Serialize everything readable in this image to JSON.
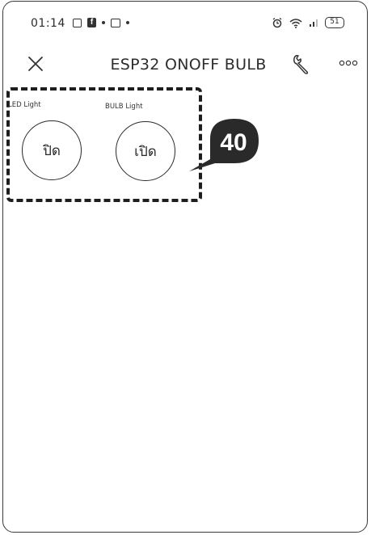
{
  "status_bar": {
    "time": "01:14",
    "battery": "51"
  },
  "header": {
    "title": "ESP32 ONOFF BULB"
  },
  "widgets": [
    {
      "label": "LED Light",
      "button_text": "ปิด"
    },
    {
      "label": "BULB Light",
      "button_text": "เปิด"
    }
  ],
  "callout": {
    "number": "40"
  },
  "colors": {
    "callout": "#2a2a2a",
    "dash": "#1e1e1e",
    "text": "#2b2b2b"
  }
}
